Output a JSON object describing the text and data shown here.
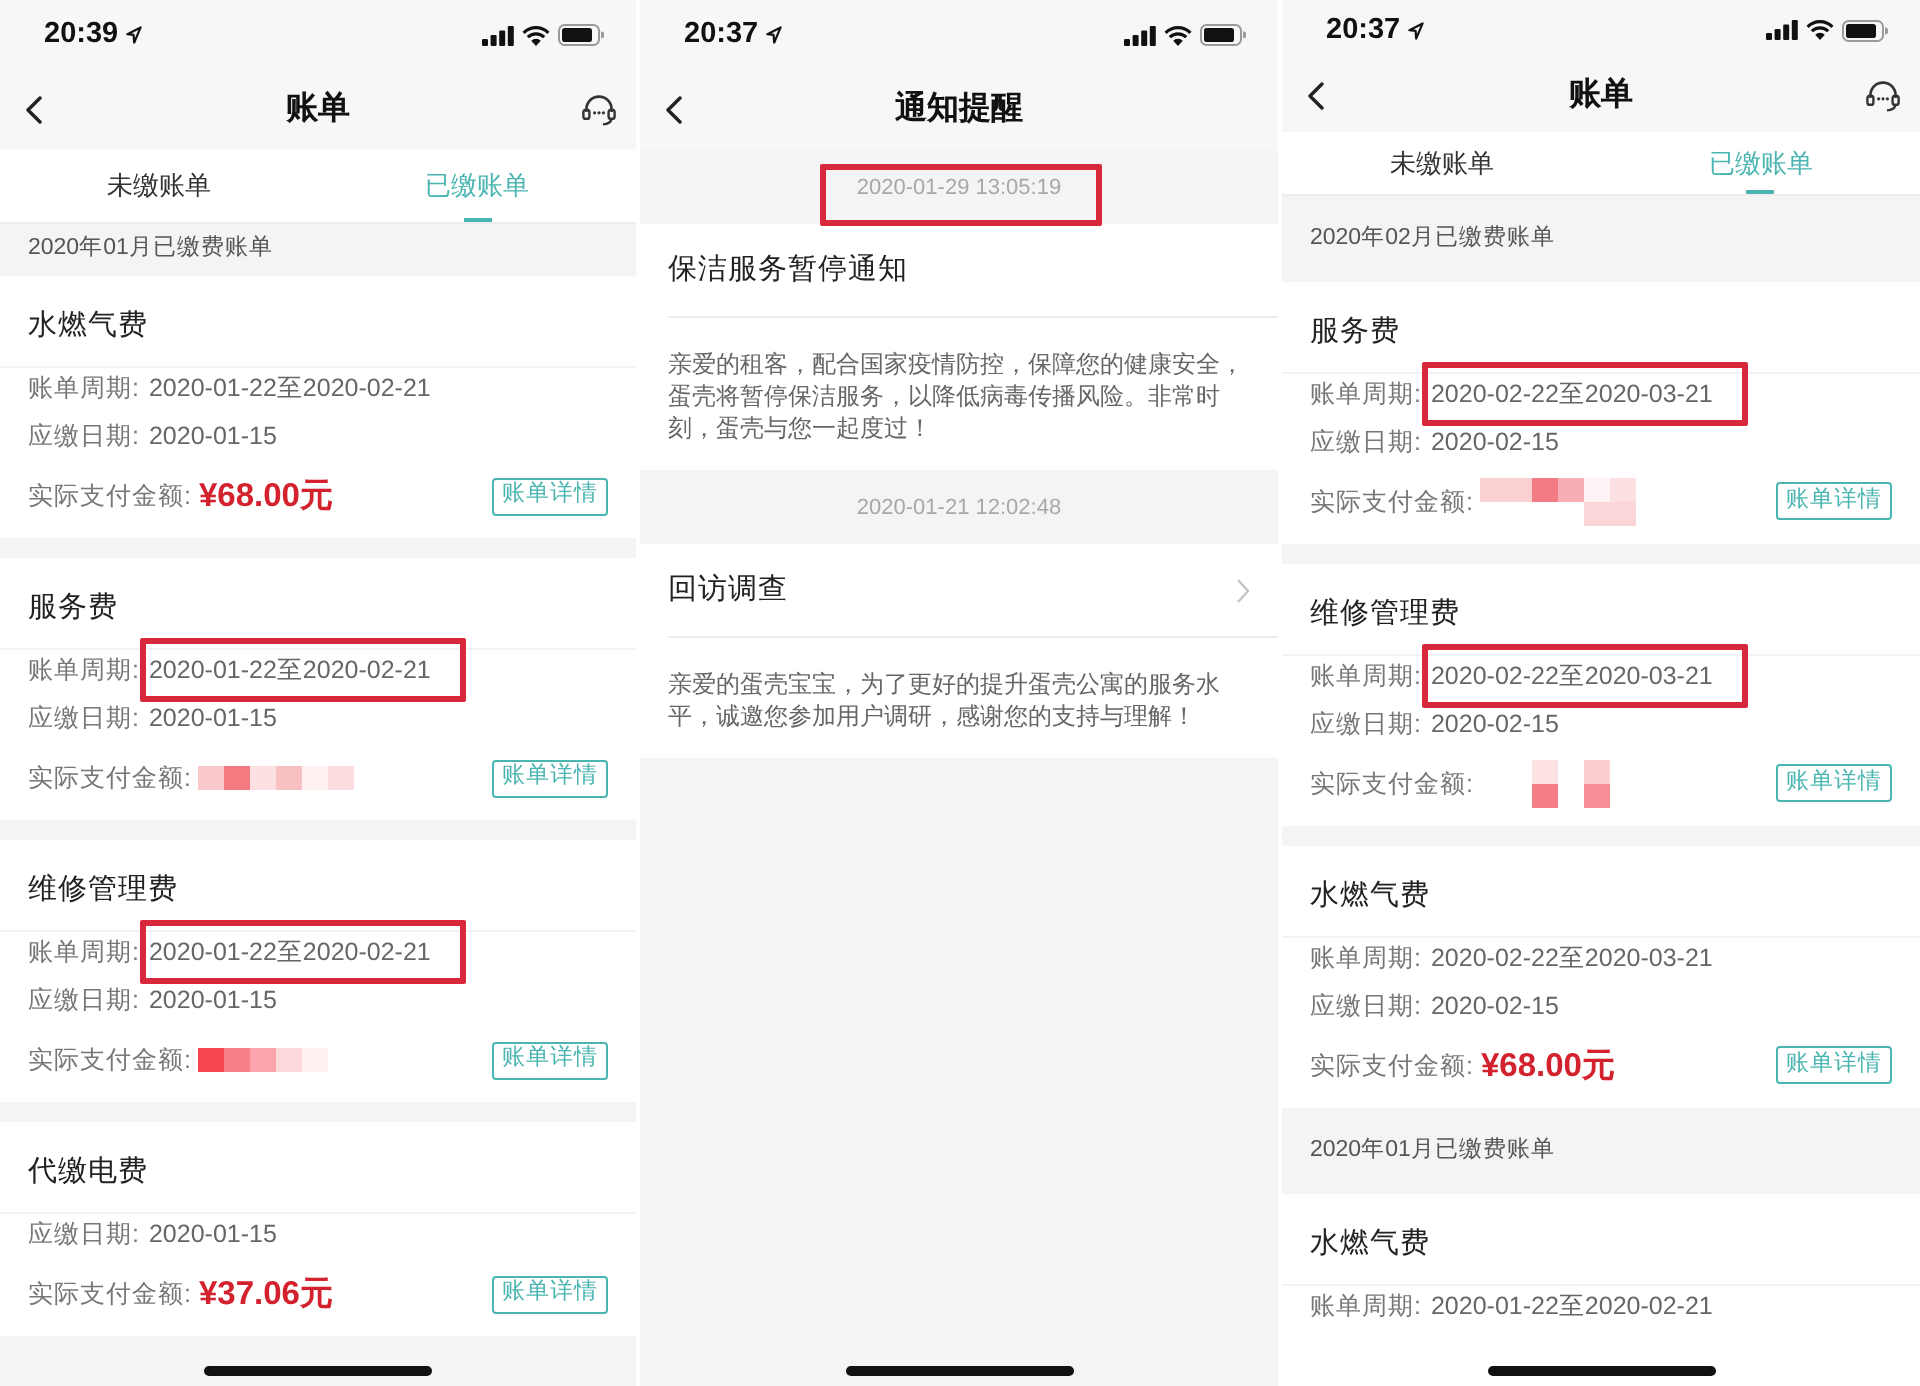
{
  "screens": [
    {
      "kind": "bills",
      "status_bar": {
        "time": "20:39"
      },
      "nav": {
        "title": "账单"
      },
      "tabs": [
        {
          "label": "未缴账单",
          "selected": false
        },
        {
          "label": "已缴账单",
          "selected": true
        }
      ],
      "sections": [
        {
          "header": "2020年01月已缴费账单",
          "bills": [
            {
              "title": "水燃气费",
              "rows": [
                {
                  "label": "账单周期:",
                  "value": "2020-01-22至2020-02-21",
                  "highlighted": false
                },
                {
                  "label": "应缴日期:",
                  "value": "2020-01-15",
                  "highlighted": false
                }
              ],
              "amount": {
                "label": "实际支付金额:",
                "kind": "text",
                "value": "¥68.00元"
              },
              "button": "账单详情"
            },
            {
              "title": "服务费",
              "rows": [
                {
                  "label": "账单周期:",
                  "value": "2020-01-22至2020-02-21",
                  "highlighted": true
                },
                {
                  "label": "应缴日期:",
                  "value": "2020-01-15",
                  "highlighted": false
                }
              ],
              "amount": {
                "label": "实际支付金额:",
                "kind": "pixelated"
              },
              "button": "账单详情"
            },
            {
              "title": "维修管理费",
              "rows": [
                {
                  "label": "账单周期:",
                  "value": "2020-01-22至2020-02-21",
                  "highlighted": true
                },
                {
                  "label": "应缴日期:",
                  "value": "2020-01-15",
                  "highlighted": false
                }
              ],
              "amount": {
                "label": "实际支付金额:",
                "kind": "pixelated"
              },
              "button": "账单详情"
            },
            {
              "title": "代缴电费",
              "rows": [
                {
                  "label": "应缴日期:",
                  "value": "2020-01-15",
                  "highlighted": false
                }
              ],
              "amount": {
                "label": "实际支付金额:",
                "kind": "text",
                "value": "¥37.06元"
              },
              "button": "账单详情"
            }
          ]
        }
      ]
    },
    {
      "kind": "notices",
      "status_bar": {
        "time": "20:37"
      },
      "nav": {
        "title": "通知提醒"
      },
      "notices": [
        {
          "time": "2020-01-29 13:05:19",
          "highlighted": true,
          "title": "保洁服务暂停通知",
          "opens_detail": false,
          "body": "亲爱的租客，配合国家疫情防控，保障您的健康安全，蛋壳将暂停保洁服务，以降低病毒传播风险。非常时刻，蛋壳与您一起度过！"
        },
        {
          "time": "2020-01-21 12:02:48",
          "highlighted": false,
          "title": "回访调查",
          "opens_detail": true,
          "body": "亲爱的蛋壳宝宝，为了更好的提升蛋壳公寓的服务水平，诚邀您参加用户调研，感谢您的支持与理解！"
        }
      ]
    },
    {
      "kind": "bills",
      "status_bar": {
        "time": "20:37"
      },
      "nav": {
        "title": "账单"
      },
      "tabs": [
        {
          "label": "未缴账单",
          "selected": false
        },
        {
          "label": "已缴账单",
          "selected": true
        }
      ],
      "sections": [
        {
          "header": "2020年02月已缴费账单",
          "bills": [
            {
              "title": "服务费",
              "rows": [
                {
                  "label": "账单周期:",
                  "value": "2020-02-22至2020-03-21",
                  "highlighted": true
                },
                {
                  "label": "应缴日期:",
                  "value": "2020-02-15",
                  "highlighted": false
                }
              ],
              "amount": {
                "label": "实际支付金额:",
                "kind": "pixelated"
              },
              "button": "账单详情"
            },
            {
              "title": "维修管理费",
              "rows": [
                {
                  "label": "账单周期:",
                  "value": "2020-02-22至2020-03-21",
                  "highlighted": true
                },
                {
                  "label": "应缴日期:",
                  "value": "2020-02-15",
                  "highlighted": false
                }
              ],
              "amount": {
                "label": "实际支付金额:",
                "kind": "pixelated"
              },
              "button": "账单详情"
            },
            {
              "title": "水燃气费",
              "rows": [
                {
                  "label": "账单周期:",
                  "value": "2020-02-22至2020-03-21",
                  "highlighted": false
                },
                {
                  "label": "应缴日期:",
                  "value": "2020-02-15",
                  "highlighted": false
                }
              ],
              "amount": {
                "label": "实际支付金额:",
                "kind": "text",
                "value": "¥68.00元"
              },
              "button": "账单详情"
            }
          ]
        },
        {
          "header": "2020年01月已缴费账单",
          "bills": [
            {
              "title": "水燃气费",
              "rows": [
                {
                  "label": "账单周期:",
                  "value": "2020-01-22至2020-02-21",
                  "highlighted": false
                }
              ]
            }
          ]
        }
      ]
    }
  ]
}
